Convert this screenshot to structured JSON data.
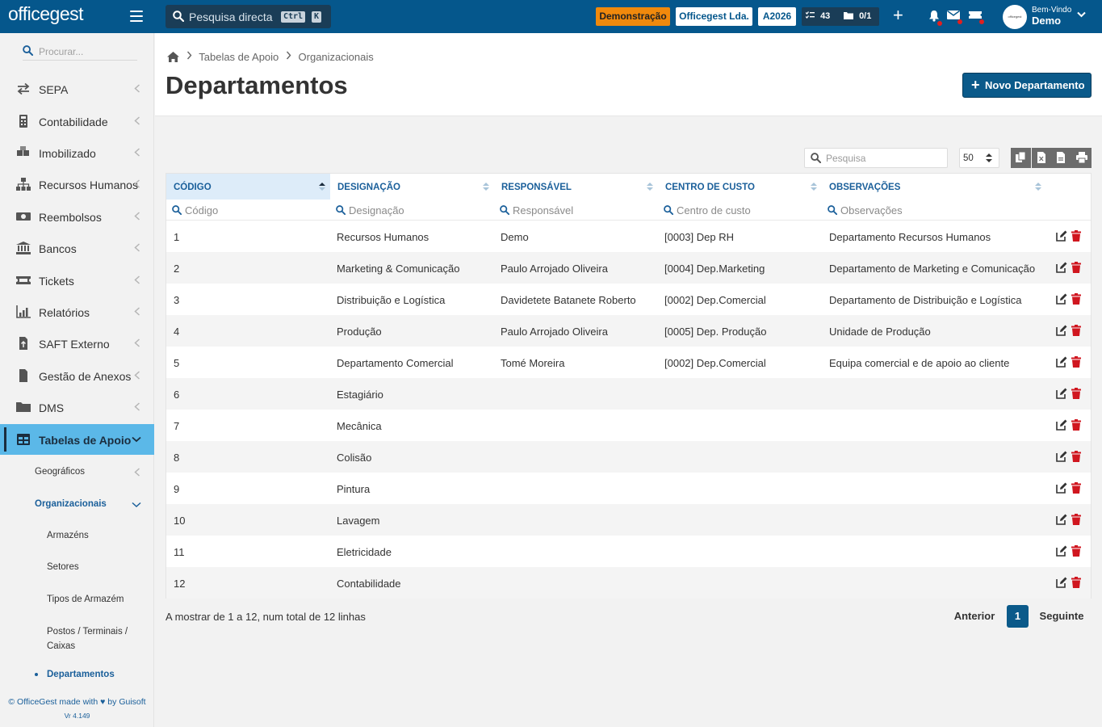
{
  "app": {
    "logo_text": "officegest",
    "search_placeholder": "Pesquisa directa",
    "kbd_ctrl": "Ctrl",
    "kbd_k": "K",
    "demo_label": "Demonstração",
    "company": "Officegest Lda.",
    "year": "A2026",
    "tasks_count": "43",
    "docs_count": "0/1",
    "welcome_small": "Bem-Vindo",
    "user_name": "Demo",
    "avatar_text": "officegest"
  },
  "sidebar": {
    "search_placeholder": "Procurar...",
    "items": [
      {
        "label": "SEPA",
        "icon": "transfer-icon"
      },
      {
        "label": "Contabilidade",
        "icon": "calculator-icon"
      },
      {
        "label": "Imobilizado",
        "icon": "boxes-icon"
      },
      {
        "label": "Recursos Humanos",
        "icon": "org-chart-icon"
      },
      {
        "label": "Reembolsos",
        "icon": "money-icon"
      },
      {
        "label": "Bancos",
        "icon": "bank-icon"
      },
      {
        "label": "Tickets",
        "icon": "ticket-icon"
      },
      {
        "label": "Relatórios",
        "icon": "chart-icon"
      },
      {
        "label": "SAFT Externo",
        "icon": "file-upload-icon"
      },
      {
        "label": "Gestão de Anexos",
        "icon": "file-icon"
      },
      {
        "label": "DMS",
        "icon": "folder-icon"
      },
      {
        "label": "Tabelas de Apoio",
        "icon": "table-icon"
      }
    ],
    "sub": {
      "geograficos": "Geográficos",
      "organizacionais": "Organizacionais",
      "armazens": "Armazéns",
      "setores": "Setores",
      "tipos_armazem": "Tipos de Armazém",
      "postos_line1": "Postos / Terminais /",
      "postos_line2": "Caixas",
      "departamentos": "Departamentos"
    },
    "footer": "© OfficeGest made with ♥ by Guisoft",
    "version": "Vr 4.149"
  },
  "breadcrumb": {
    "level1": "Tabelas de Apoio",
    "level2": "Organizacionais"
  },
  "page": {
    "title": "Departamentos",
    "new_button": "Novo Departamento"
  },
  "toolbar": {
    "search_placeholder": "Pesquisa",
    "page_size": "50"
  },
  "table": {
    "columns": [
      "CÓDIGO",
      "DESIGNAÇÃO",
      "RESPONSÁVEL",
      "CENTRO DE CUSTO",
      "OBSERVAÇÕES"
    ],
    "filters": [
      "Código",
      "Designação",
      "Responsável",
      "Centro de custo",
      "Observações"
    ],
    "rows": [
      {
        "codigo": "1",
        "designacao": "Recursos Humanos",
        "responsavel": "Demo",
        "centro": "[0003] Dep RH",
        "obs": "Departamento Recursos Humanos"
      },
      {
        "codigo": "2",
        "designacao": "Marketing & Comunicação",
        "responsavel": "Paulo Arrojado Oliveira",
        "centro": "[0004] Dep.Marketing",
        "obs": "Departamento de Marketing e Comunicação"
      },
      {
        "codigo": "3",
        "designacao": "Distribuição e Logística",
        "responsavel": "Davidetete Batanete Roberto",
        "centro": "[0002] Dep.Comercial",
        "obs": "Departamento de Distribuição e Logística"
      },
      {
        "codigo": "4",
        "designacao": "Produção",
        "responsavel": "Paulo Arrojado Oliveira",
        "centro": "[0005] Dep. Produção",
        "obs": "Unidade de Produção"
      },
      {
        "codigo": "5",
        "designacao": "Departamento Comercial",
        "responsavel": "Tomé Moreira",
        "centro": "[0002] Dep.Comercial",
        "obs": "Equipa comercial e de apoio ao cliente"
      },
      {
        "codigo": "6",
        "designacao": "Estagiário",
        "responsavel": "",
        "centro": "",
        "obs": ""
      },
      {
        "codigo": "7",
        "designacao": "Mecânica",
        "responsavel": "",
        "centro": "",
        "obs": ""
      },
      {
        "codigo": "8",
        "designacao": "Colisão",
        "responsavel": "",
        "centro": "",
        "obs": ""
      },
      {
        "codigo": "9",
        "designacao": "Pintura",
        "responsavel": "",
        "centro": "",
        "obs": ""
      },
      {
        "codigo": "10",
        "designacao": "Lavagem",
        "responsavel": "",
        "centro": "",
        "obs": ""
      },
      {
        "codigo": "11",
        "designacao": "Eletricidade",
        "responsavel": "",
        "centro": "",
        "obs": ""
      },
      {
        "codigo": "12",
        "designacao": "Contabilidade",
        "responsavel": "",
        "centro": "",
        "obs": ""
      }
    ]
  },
  "pagination": {
    "info": "A mostrar de 1 a 12, num total de 12 linhas",
    "prev": "Anterior",
    "current": "1",
    "next": "Seguinte"
  },
  "colors": {
    "topbar": "#05578c",
    "accent": "#1a5f9a",
    "active_nav": "#5bb8e8",
    "demo": "#f0890c",
    "delete": "#d0161f"
  }
}
